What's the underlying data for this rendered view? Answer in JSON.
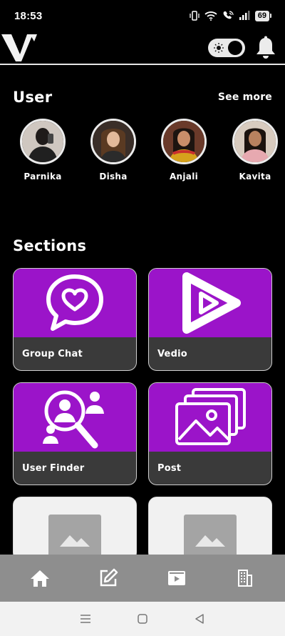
{
  "status_bar": {
    "time": "18:53",
    "battery": "69",
    "icons": [
      "vibrate-icon",
      "wifi-icon",
      "wifi-call-icon",
      "signal-icon",
      "battery-icon"
    ]
  },
  "header": {
    "logo_letter": "V",
    "theme_toggle": {
      "icon": "sun-icon",
      "state": "dark"
    },
    "bell_icon": "bell-icon"
  },
  "users_section": {
    "title": "User",
    "see_more": "See more",
    "users": [
      {
        "name": "Parnika"
      },
      {
        "name": "Disha"
      },
      {
        "name": "Anjali"
      },
      {
        "name": "Kavita"
      }
    ]
  },
  "sections": {
    "title": "Sections",
    "cards": [
      {
        "label": "Group Chat",
        "icon": "chat-heart-icon"
      },
      {
        "label": "Vedio",
        "icon": "play-icon"
      },
      {
        "label": "User Finder",
        "icon": "user-search-icon"
      },
      {
        "label": "Post",
        "icon": "images-icon"
      },
      {
        "label": "",
        "icon": "image-placeholder-icon"
      },
      {
        "label": "",
        "icon": "image-placeholder-icon"
      }
    ]
  },
  "bottom_nav": {
    "items": [
      {
        "icon": "home-icon"
      },
      {
        "icon": "edit-icon"
      },
      {
        "icon": "video-icon"
      },
      {
        "icon": "building-icon"
      }
    ]
  },
  "system_nav": {
    "items": [
      "menu-icon",
      "home-square-icon",
      "back-triangle-icon"
    ]
  },
  "colors": {
    "accent": "#9b14c9",
    "card_footer": "#3a3a3a",
    "nav_bg": "#8e8e8e",
    "background": "#000000"
  }
}
